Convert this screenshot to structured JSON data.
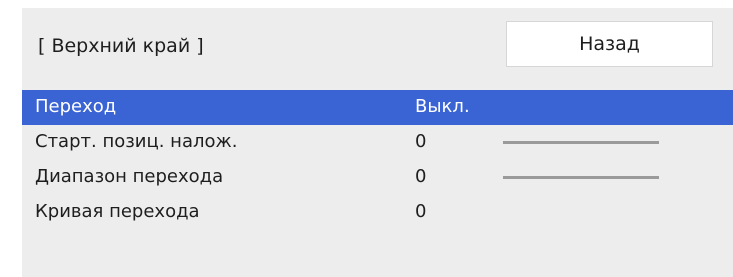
{
  "header": {
    "title": "[ Верхний край ]",
    "back_label": "Назад"
  },
  "menu": {
    "selected_index": 0,
    "rows": [
      {
        "label": "Переход",
        "value": "Выкл.",
        "has_slider": false
      },
      {
        "label": "Старт. позиц. налож.",
        "value": "0",
        "has_slider": true
      },
      {
        "label": "Диапазон перехода",
        "value": "0",
        "has_slider": true
      },
      {
        "label": "Кривая перехода",
        "value": "0",
        "has_slider": false
      }
    ]
  },
  "colors": {
    "selected_row": "#3a63d4",
    "panel_background": "#ededed"
  }
}
